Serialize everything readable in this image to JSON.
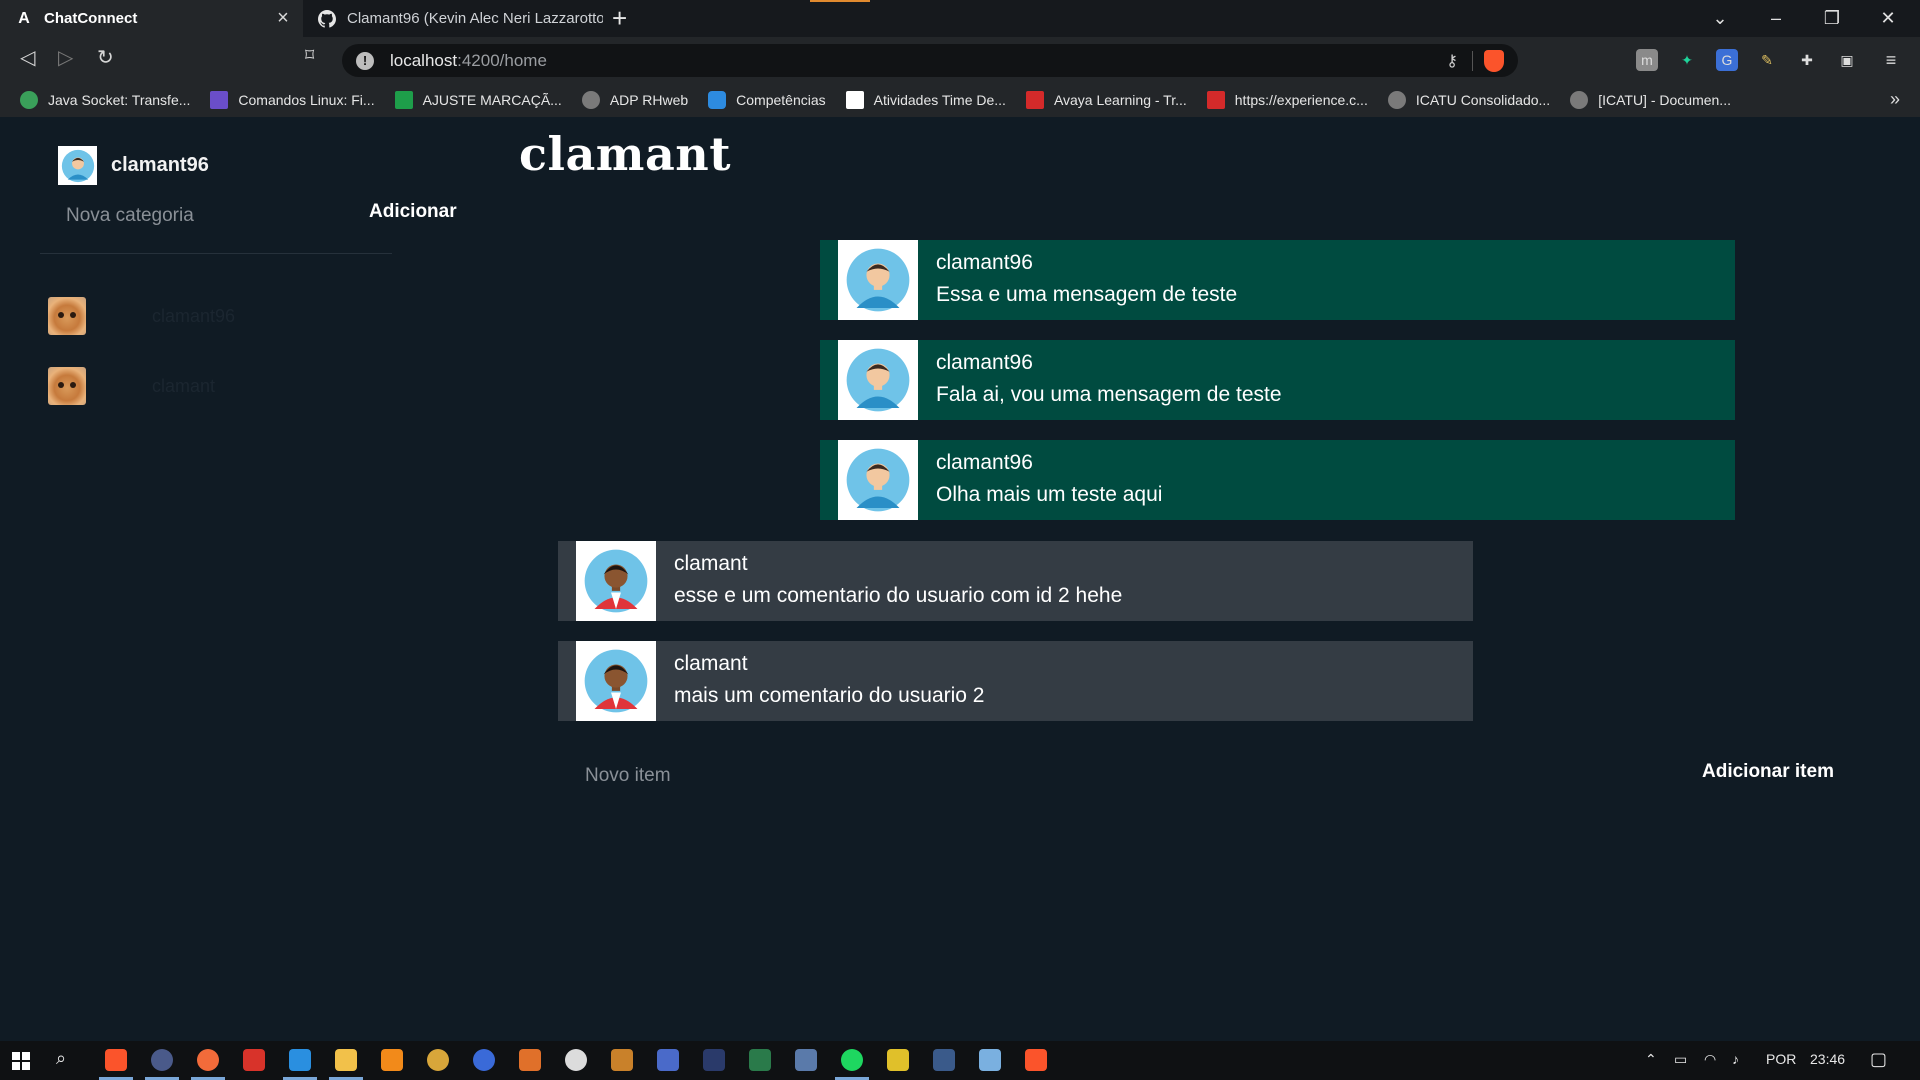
{
  "browser": {
    "tabs": [
      {
        "title": "ChatConnect",
        "icon": "app-a-icon",
        "active": true
      },
      {
        "title": "Clamant96 (Kevin Alec Neri Lazzarotto",
        "icon": "github-icon",
        "active": false
      }
    ],
    "url_host": "localhost",
    "url_path": ":4200/home",
    "bookmarks": [
      {
        "label": "Java Socket: Transfe...",
        "color": "#3aa05a"
      },
      {
        "label": "Comandos Linux: Fi...",
        "color": "#6a4ec9"
      },
      {
        "label": "AJUSTE MARCAÇÃ...",
        "color": "#1e9e4a"
      },
      {
        "label": "ADP RHweb",
        "color": "#7a7a7a"
      },
      {
        "label": "Competências",
        "color": "#2d8be0"
      },
      {
        "label": "Atividades Time De...",
        "color": "#ffffff"
      },
      {
        "label": "Avaya Learning - Tr...",
        "color": "#d42a2a"
      },
      {
        "label": "https://experience.c...",
        "color": "#d42a2a"
      },
      {
        "label": "ICATU Consolidado...",
        "color": "#7a7a7a"
      },
      {
        "label": "[ICATU] - Documen...",
        "color": "#7a7a7a"
      }
    ],
    "bookmarks_more": "»"
  },
  "sidebar": {
    "username": "clamant96",
    "category_placeholder": "Nova categoria",
    "add_label": "Adicionar",
    "contacts": [
      {
        "name": "clamant96"
      },
      {
        "name": "clamant"
      }
    ]
  },
  "room": {
    "title": "clamant",
    "messages": [
      {
        "author": "clamant96",
        "text": "Essa e uma mensagem de teste",
        "own": true
      },
      {
        "author": "clamant96",
        "text": "Fala ai, vou uma mensagem de teste",
        "own": true
      },
      {
        "author": "clamant96",
        "text": "Olha mais um teste aqui",
        "own": true
      },
      {
        "author": "clamant",
        "text": "esse e um comentario do usuario com id 2 hehe",
        "own": false
      },
      {
        "author": "clamant",
        "text": "mais um comentario do usuario 2",
        "own": false
      }
    ],
    "item_placeholder": "Novo item",
    "item_add_label": "Adicionar item"
  },
  "taskbar": {
    "language": "POR",
    "time": "23:46"
  },
  "colors": {
    "background": "#101b24",
    "own_message": "#004b40",
    "other_message": "#343c44"
  }
}
